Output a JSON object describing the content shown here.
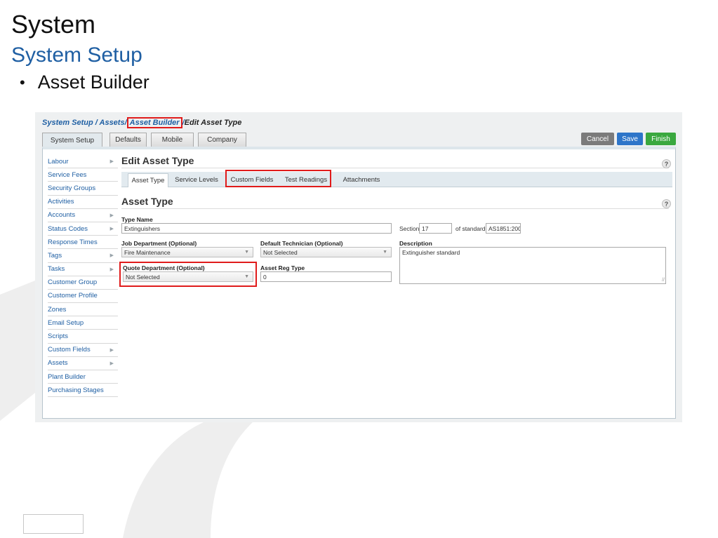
{
  "slide": {
    "title": "System",
    "subtitle": "System Setup",
    "bullet": "Asset Builder"
  },
  "breadcrumb": {
    "part1": "System Setup / Assets",
    "sep": "/",
    "part2": "Asset Builder",
    "current": "Edit Asset Type"
  },
  "top_tabs": [
    "System Setup",
    "Defaults",
    "Mobile",
    "Company"
  ],
  "buttons": {
    "cancel": "Cancel",
    "save": "Save",
    "finish": "Finish"
  },
  "sidebar": {
    "items": [
      {
        "label": "Labour",
        "arrow": "▶"
      },
      {
        "label": "Service Fees",
        "arrow": ""
      },
      {
        "label": "Security Groups",
        "arrow": ""
      },
      {
        "label": "Activities",
        "arrow": ""
      },
      {
        "label": "Accounts",
        "arrow": "▶"
      },
      {
        "label": "Status Codes",
        "arrow": "▶"
      },
      {
        "label": "Response Times",
        "arrow": ""
      },
      {
        "label": "Tags",
        "arrow": "▶"
      },
      {
        "label": "Tasks",
        "arrow": "▶"
      },
      {
        "label": "Customer Group",
        "arrow": ""
      },
      {
        "label": "Customer Profile",
        "arrow": ""
      },
      {
        "label": "Zones",
        "arrow": ""
      },
      {
        "label": "Email Setup",
        "arrow": ""
      },
      {
        "label": "Scripts",
        "arrow": ""
      },
      {
        "label": "Custom Fields",
        "arrow": "▶"
      },
      {
        "label": "Assets",
        "arrow": "▶"
      },
      {
        "label": "Plant Builder",
        "arrow": ""
      },
      {
        "label": "Purchasing Stages",
        "arrow": ""
      }
    ]
  },
  "edit": {
    "heading": "Edit Asset Type",
    "help": "?",
    "tabs": [
      "Asset Type",
      "Service Levels",
      "Custom Fields",
      "Test Readings",
      "Attachments"
    ]
  },
  "asset_type": {
    "heading": "Asset Type",
    "help": "?",
    "type_name_label": "Type Name",
    "type_name_value": "Extinguishers",
    "section_label": "Section",
    "section_value": "17",
    "of_standard_label": "of standard",
    "standard_value": "AS1851:200",
    "job_department_label": "Job Department (Optional)",
    "job_department_value": "Fire Maintenance",
    "default_technician_label": "Default Technician (Optional)",
    "default_technician_value": "Not Selected",
    "description_label": "Description",
    "description_value": "Extinguisher standard",
    "quote_department_label": "Quote Department (Optional)",
    "quote_department_value": "Not Selected",
    "asset_reg_type_label": "Asset Reg Type",
    "asset_reg_type_value": "0"
  },
  "icons": {
    "dropdown": "▼",
    "resize": "//"
  },
  "colors": {
    "link_blue": "#1f5fa3",
    "highlight_red": "#e01b1b",
    "save_blue": "#2d75c9",
    "finish_green": "#3aa83f",
    "cancel_gray": "#7b7b7b"
  }
}
